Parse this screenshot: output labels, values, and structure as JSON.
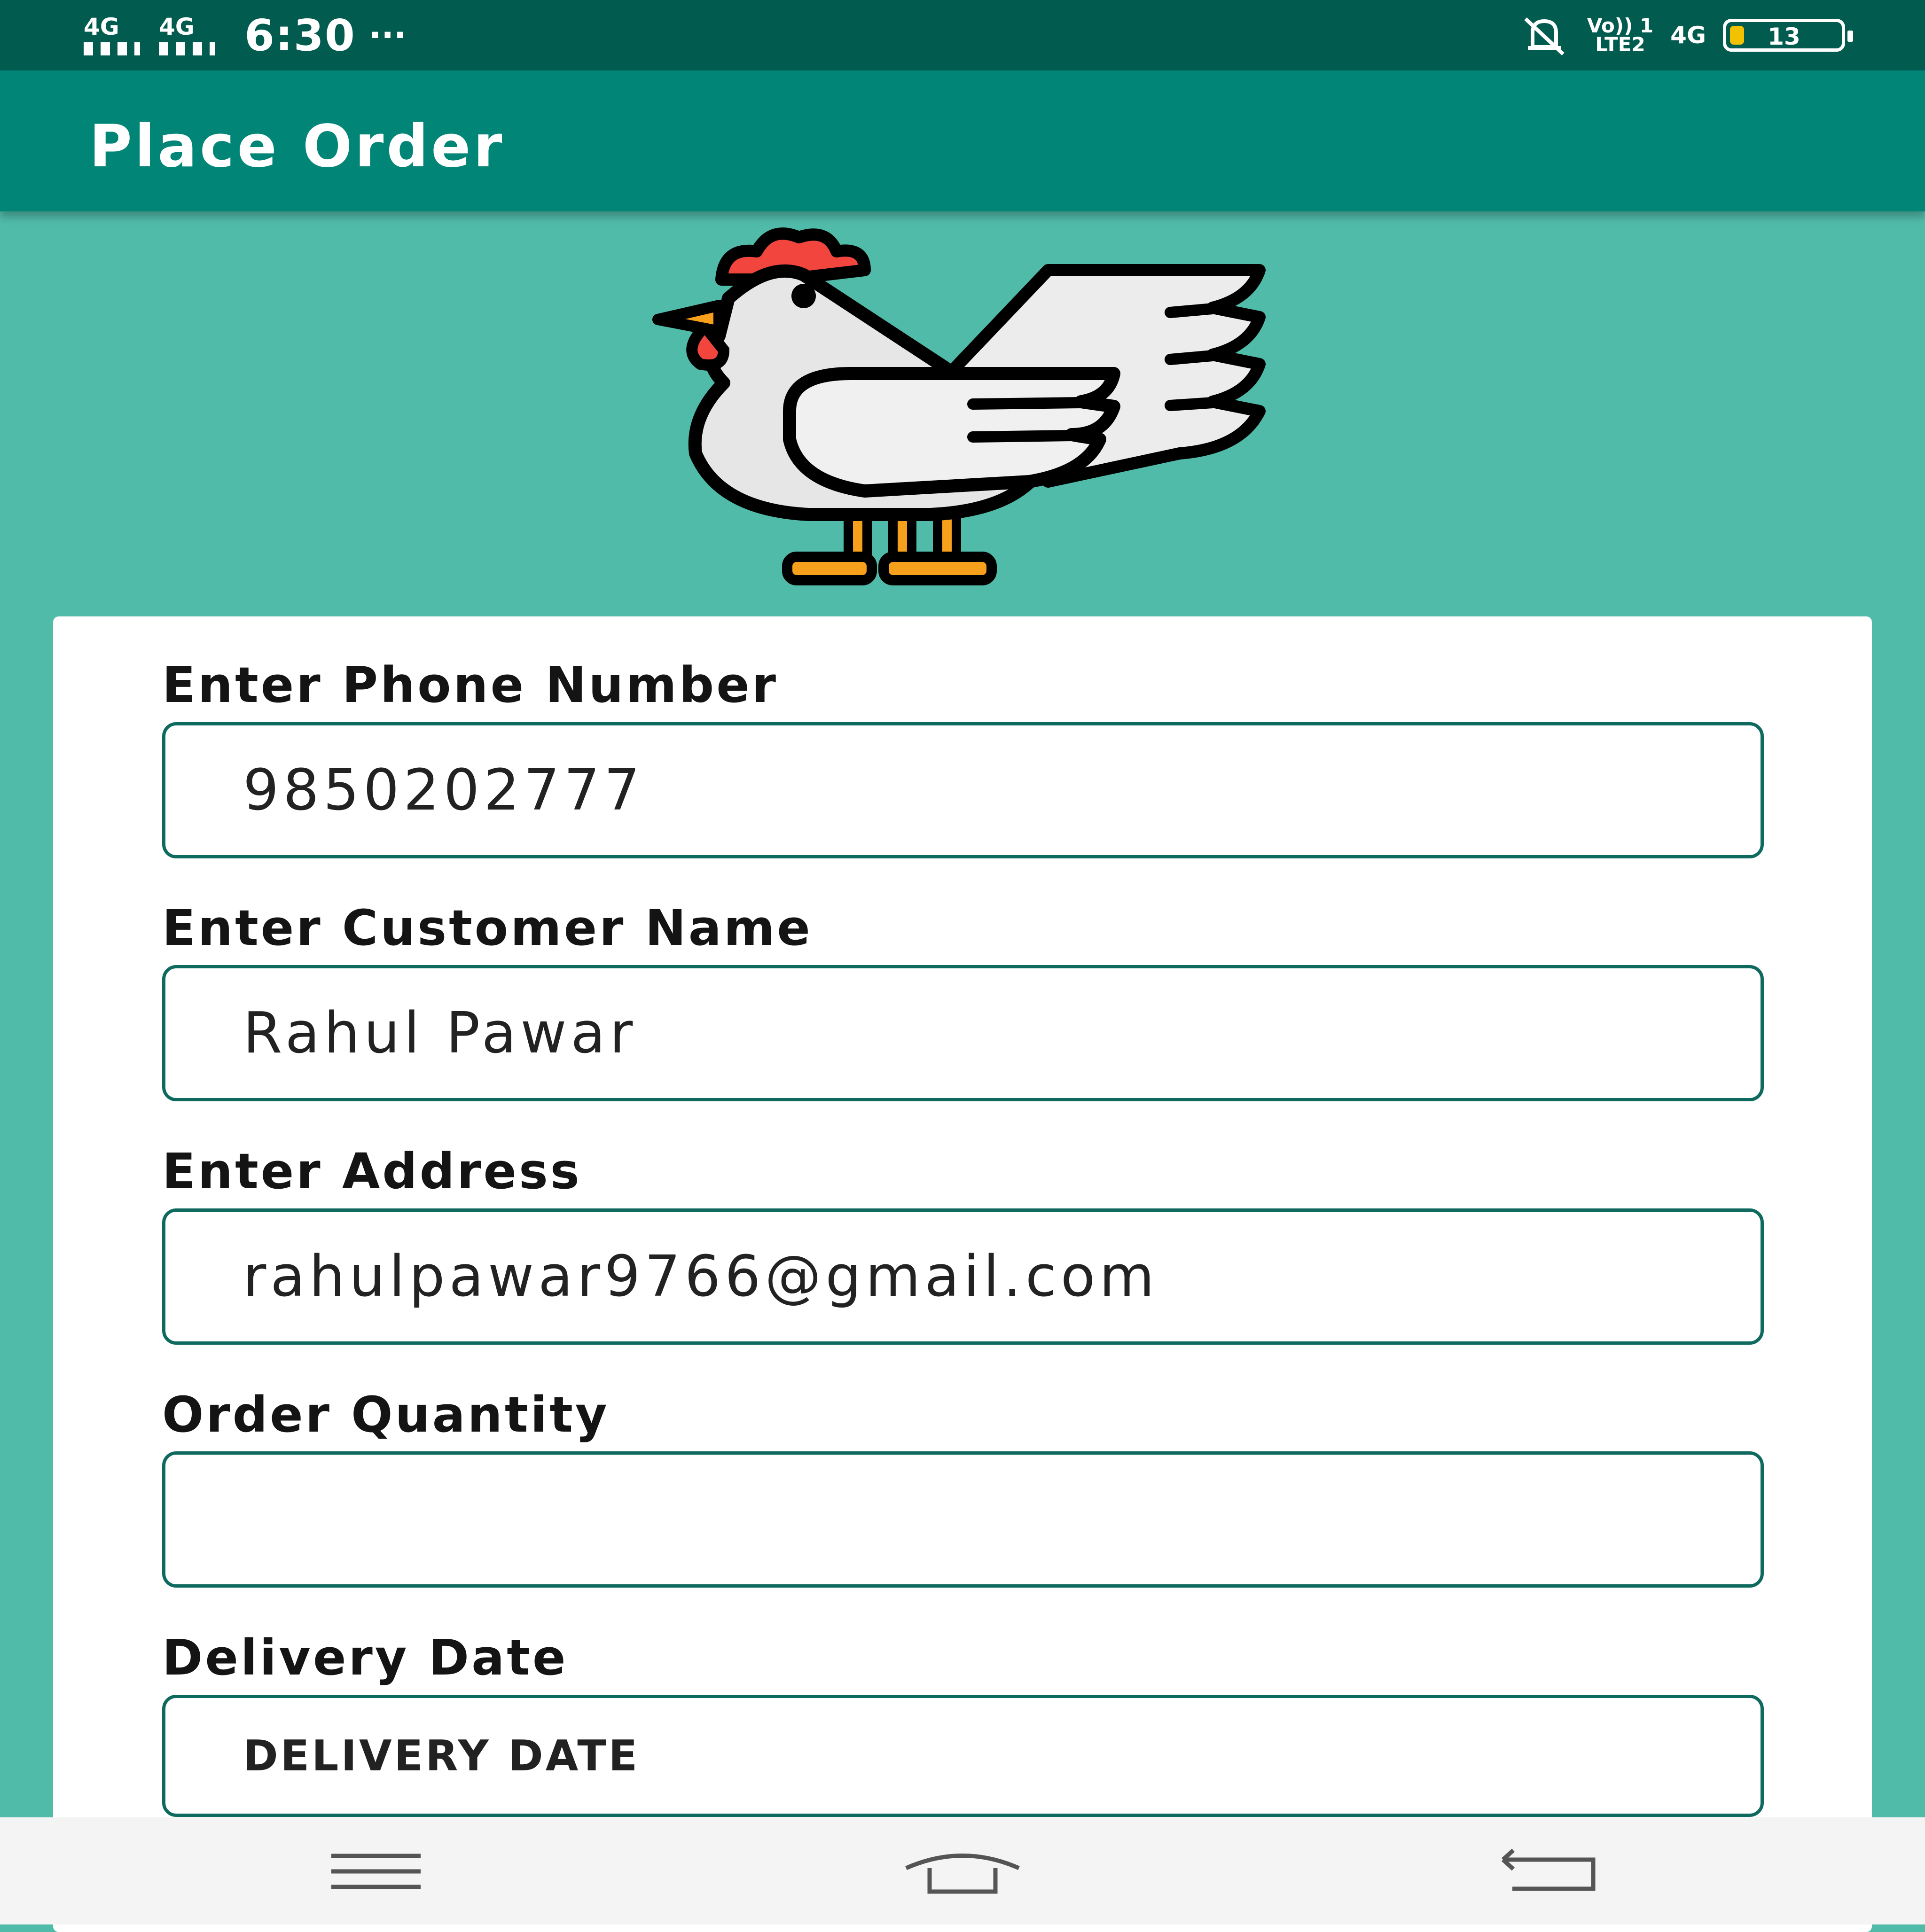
{
  "status_bar": {
    "network1": "4G",
    "network2": "4G",
    "time": "6:30",
    "more_dots": "···",
    "volte_line1": "Vo)) 1",
    "volte_line2": "LTE2",
    "network_right": "4G",
    "battery_percent": "13",
    "battery_level": 0.13,
    "icons": [
      "signal-icon",
      "silent-bell-icon",
      "battery-icon"
    ]
  },
  "app_bar": {
    "title": "Place Order"
  },
  "logo": {
    "icon": "rooster-icon"
  },
  "form": {
    "phone": {
      "label": "Enter Phone Number",
      "value": "9850202777"
    },
    "customer_name": {
      "label": "Enter Customer Name",
      "value": "Rahul Pawar"
    },
    "address": {
      "label": "Enter Address",
      "value": "rahulpawar9766@gmail.com"
    },
    "quantity": {
      "label": "Order Quantity",
      "value": ""
    },
    "delivery_date": {
      "label": "Delivery Date",
      "button_label": "DELIVERY DATE"
    }
  },
  "nav_bar": {
    "icons": [
      "menu-icon",
      "home-icon",
      "back-icon"
    ]
  },
  "colors": {
    "status_bar": "#015c4f",
    "app_bar": "#018577",
    "background": "#51bbaa",
    "field_border": "#0e6a5e",
    "battery": "#f2c200"
  }
}
